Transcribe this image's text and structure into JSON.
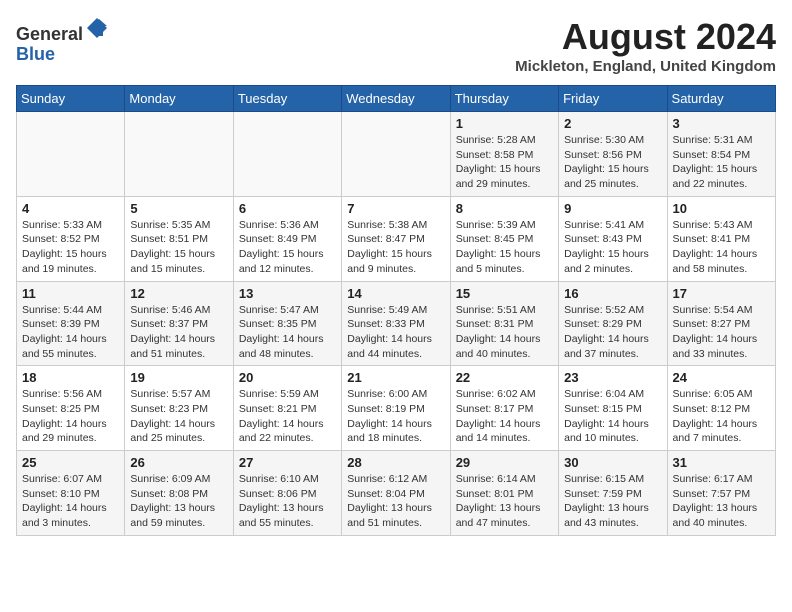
{
  "header": {
    "logo_general": "General",
    "logo_blue": "Blue",
    "month_year": "August 2024",
    "location": "Mickleton, England, United Kingdom"
  },
  "days_of_week": [
    "Sunday",
    "Monday",
    "Tuesday",
    "Wednesday",
    "Thursday",
    "Friday",
    "Saturday"
  ],
  "weeks": [
    [
      {
        "day": "",
        "info": ""
      },
      {
        "day": "",
        "info": ""
      },
      {
        "day": "",
        "info": ""
      },
      {
        "day": "",
        "info": ""
      },
      {
        "day": "1",
        "info": "Sunrise: 5:28 AM\nSunset: 8:58 PM\nDaylight: 15 hours\nand 29 minutes."
      },
      {
        "day": "2",
        "info": "Sunrise: 5:30 AM\nSunset: 8:56 PM\nDaylight: 15 hours\nand 25 minutes."
      },
      {
        "day": "3",
        "info": "Sunrise: 5:31 AM\nSunset: 8:54 PM\nDaylight: 15 hours\nand 22 minutes."
      }
    ],
    [
      {
        "day": "4",
        "info": "Sunrise: 5:33 AM\nSunset: 8:52 PM\nDaylight: 15 hours\nand 19 minutes."
      },
      {
        "day": "5",
        "info": "Sunrise: 5:35 AM\nSunset: 8:51 PM\nDaylight: 15 hours\nand 15 minutes."
      },
      {
        "day": "6",
        "info": "Sunrise: 5:36 AM\nSunset: 8:49 PM\nDaylight: 15 hours\nand 12 minutes."
      },
      {
        "day": "7",
        "info": "Sunrise: 5:38 AM\nSunset: 8:47 PM\nDaylight: 15 hours\nand 9 minutes."
      },
      {
        "day": "8",
        "info": "Sunrise: 5:39 AM\nSunset: 8:45 PM\nDaylight: 15 hours\nand 5 minutes."
      },
      {
        "day": "9",
        "info": "Sunrise: 5:41 AM\nSunset: 8:43 PM\nDaylight: 15 hours\nand 2 minutes."
      },
      {
        "day": "10",
        "info": "Sunrise: 5:43 AM\nSunset: 8:41 PM\nDaylight: 14 hours\nand 58 minutes."
      }
    ],
    [
      {
        "day": "11",
        "info": "Sunrise: 5:44 AM\nSunset: 8:39 PM\nDaylight: 14 hours\nand 55 minutes."
      },
      {
        "day": "12",
        "info": "Sunrise: 5:46 AM\nSunset: 8:37 PM\nDaylight: 14 hours\nand 51 minutes."
      },
      {
        "day": "13",
        "info": "Sunrise: 5:47 AM\nSunset: 8:35 PM\nDaylight: 14 hours\nand 48 minutes."
      },
      {
        "day": "14",
        "info": "Sunrise: 5:49 AM\nSunset: 8:33 PM\nDaylight: 14 hours\nand 44 minutes."
      },
      {
        "day": "15",
        "info": "Sunrise: 5:51 AM\nSunset: 8:31 PM\nDaylight: 14 hours\nand 40 minutes."
      },
      {
        "day": "16",
        "info": "Sunrise: 5:52 AM\nSunset: 8:29 PM\nDaylight: 14 hours\nand 37 minutes."
      },
      {
        "day": "17",
        "info": "Sunrise: 5:54 AM\nSunset: 8:27 PM\nDaylight: 14 hours\nand 33 minutes."
      }
    ],
    [
      {
        "day": "18",
        "info": "Sunrise: 5:56 AM\nSunset: 8:25 PM\nDaylight: 14 hours\nand 29 minutes."
      },
      {
        "day": "19",
        "info": "Sunrise: 5:57 AM\nSunset: 8:23 PM\nDaylight: 14 hours\nand 25 minutes."
      },
      {
        "day": "20",
        "info": "Sunrise: 5:59 AM\nSunset: 8:21 PM\nDaylight: 14 hours\nand 22 minutes."
      },
      {
        "day": "21",
        "info": "Sunrise: 6:00 AM\nSunset: 8:19 PM\nDaylight: 14 hours\nand 18 minutes."
      },
      {
        "day": "22",
        "info": "Sunrise: 6:02 AM\nSunset: 8:17 PM\nDaylight: 14 hours\nand 14 minutes."
      },
      {
        "day": "23",
        "info": "Sunrise: 6:04 AM\nSunset: 8:15 PM\nDaylight: 14 hours\nand 10 minutes."
      },
      {
        "day": "24",
        "info": "Sunrise: 6:05 AM\nSunset: 8:12 PM\nDaylight: 14 hours\nand 7 minutes."
      }
    ],
    [
      {
        "day": "25",
        "info": "Sunrise: 6:07 AM\nSunset: 8:10 PM\nDaylight: 14 hours\nand 3 minutes."
      },
      {
        "day": "26",
        "info": "Sunrise: 6:09 AM\nSunset: 8:08 PM\nDaylight: 13 hours\nand 59 minutes."
      },
      {
        "day": "27",
        "info": "Sunrise: 6:10 AM\nSunset: 8:06 PM\nDaylight: 13 hours\nand 55 minutes."
      },
      {
        "day": "28",
        "info": "Sunrise: 6:12 AM\nSunset: 8:04 PM\nDaylight: 13 hours\nand 51 minutes."
      },
      {
        "day": "29",
        "info": "Sunrise: 6:14 AM\nSunset: 8:01 PM\nDaylight: 13 hours\nand 47 minutes."
      },
      {
        "day": "30",
        "info": "Sunrise: 6:15 AM\nSunset: 7:59 PM\nDaylight: 13 hours\nand 43 minutes."
      },
      {
        "day": "31",
        "info": "Sunrise: 6:17 AM\nSunset: 7:57 PM\nDaylight: 13 hours\nand 40 minutes."
      }
    ]
  ]
}
